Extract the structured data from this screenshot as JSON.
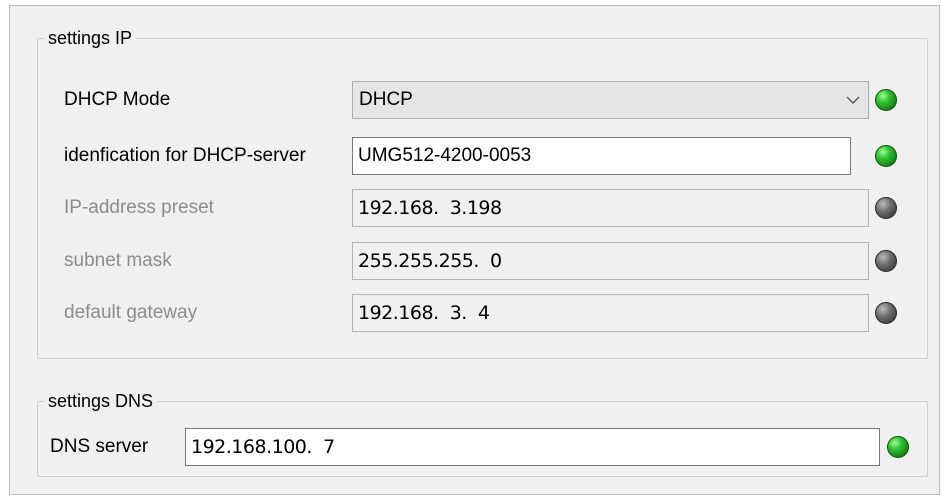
{
  "ip_group": {
    "legend": "settings IP",
    "dhcp_mode": {
      "label": "DHCP Mode",
      "value": "DHCP",
      "led": "green"
    },
    "dhcp_id": {
      "label": "idenfication for DHCP-server",
      "value": "UMG512-4200-0053",
      "led": "green"
    },
    "ip_preset": {
      "label": "IP-address preset",
      "value": "192.168.  3.198",
      "led": "gray"
    },
    "subnet": {
      "label": "subnet mask",
      "value": "255.255.255.  0",
      "led": "gray"
    },
    "gateway": {
      "label": "default gateway",
      "value": "192.168.  3.  4",
      "led": "gray"
    }
  },
  "dns_group": {
    "legend": "settings DNS",
    "dns_server": {
      "label": "DNS server",
      "value": "192.168.100.  7",
      "led": "green"
    }
  },
  "colors": {
    "led_green": "#2fc22f",
    "led_gray": "#6e6e6e",
    "disabled_text": "#8c8c8c"
  }
}
